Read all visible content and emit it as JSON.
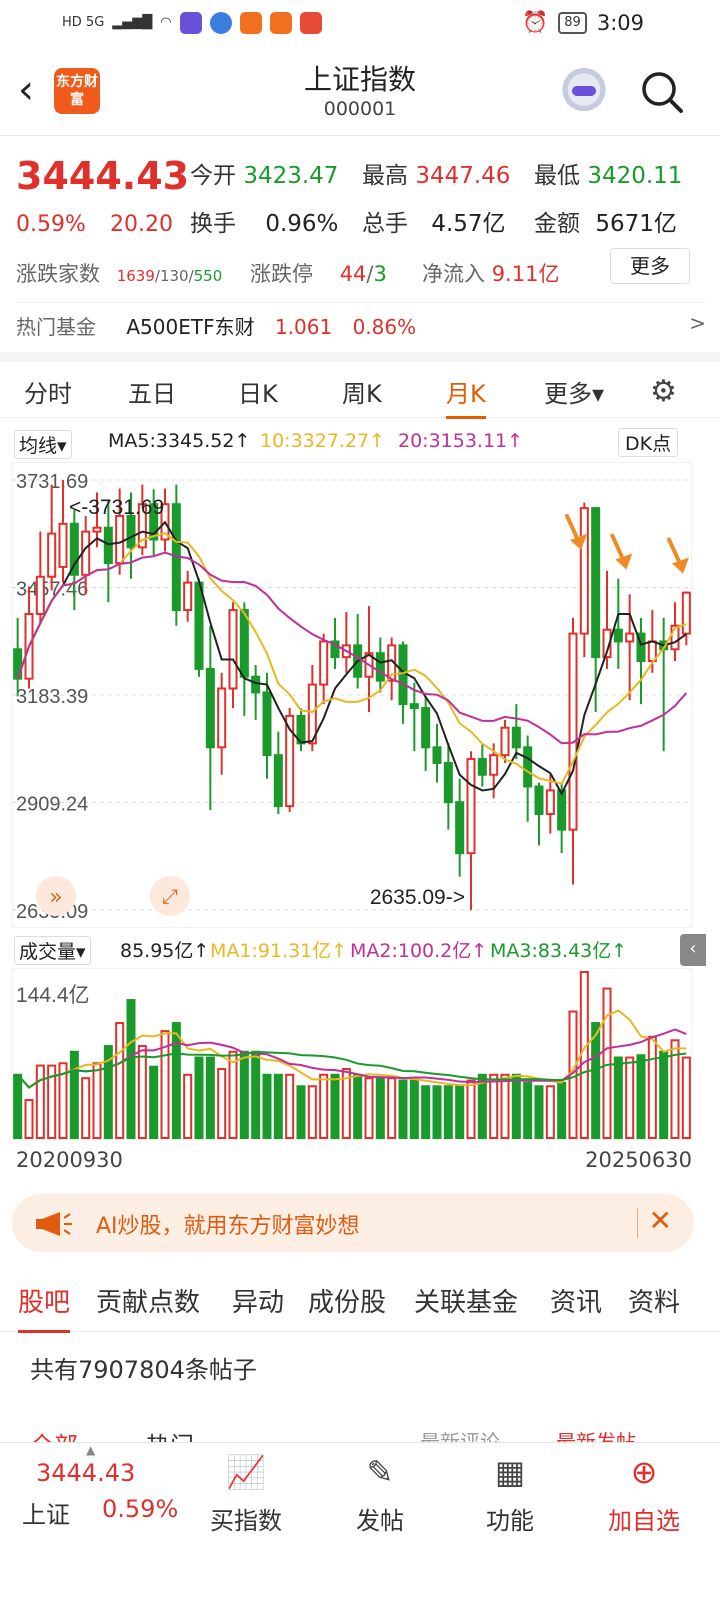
{
  "status_bar": {
    "left_label": "HD 5G",
    "battery": "89",
    "time": "3:09"
  },
  "header": {
    "logo_text": "东方财富",
    "title": "上证指数",
    "code": "000001"
  },
  "quote": {
    "price": "3444.43",
    "change_pct": "0.59%",
    "change_abs": "20.20",
    "open_label": "今开",
    "open": "3423.47",
    "high_label": "最高",
    "high": "3447.46",
    "low_label": "最低",
    "low": "3420.11",
    "turnover_label": "换手",
    "turnover": "0.96%",
    "volume_label": "总手",
    "volume": "4.57亿",
    "amount_label": "金额",
    "amount": "5671亿",
    "breadth_label": "涨跌家数",
    "breadth_up": "1639",
    "breadth_flat": "130",
    "breadth_down": "550",
    "limit_label": "涨跌停",
    "limit_up": "44",
    "limit_down": "3",
    "netflow_label": "净流入",
    "netflow": "9.11亿",
    "more_button": "更多"
  },
  "hot_fund": {
    "label": "热门基金",
    "name": "A500ETF东财",
    "price": "1.061",
    "pct": "0.86%",
    "arrow": ">"
  },
  "period_tabs": [
    {
      "label": "分时"
    },
    {
      "label": "五日"
    },
    {
      "label": "日K"
    },
    {
      "label": "周K"
    },
    {
      "label": "月K"
    },
    {
      "label": "更多▾"
    }
  ],
  "ma_bar": {
    "selector": "均线▾",
    "ma5": "MA5:3345.52↑",
    "ma10": "10:3327.27↑",
    "ma20": "20:3153.11↑",
    "dk": "DK点"
  },
  "vol_bar": {
    "selector": "成交量▾",
    "vol": "85.95亿↑",
    "ma1": "MA1:91.31亿↑",
    "ma2": "MA2:100.2亿↑",
    "ma3": "MA3:83.43亿↑"
  },
  "colors": {
    "up": "#e0302b",
    "down": "#1a9a2b",
    "ma5": "#222222",
    "ma10": "#e8b820",
    "ma20": "#c0309a",
    "accent": "#e65c00",
    "arrow": "#f08a24"
  },
  "chart_data": {
    "type": "candlestick",
    "y_ticks": [
      "3731.69",
      "3457.46",
      "3183.39",
      "2909.24",
      "2635.09"
    ],
    "ylim": [
      2635.09,
      3731.69
    ],
    "max_label": "<-3731.69",
    "min_label": "2635.09->",
    "x_labels": [
      "20200930",
      "20250630"
    ],
    "vol_tick": "144.4亿",
    "vol_max": 144.4,
    "candles": [
      {
        "o": 3300,
        "c": 3225,
        "h": 3380,
        "l": 3180,
        "v": 55
      },
      {
        "o": 3225,
        "c": 3390,
        "h": 3460,
        "l": 3200,
        "v": 33
      },
      {
        "o": 3390,
        "c": 3485,
        "h": 3600,
        "l": 3365,
        "v": 63
      },
      {
        "o": 3485,
        "c": 3595,
        "h": 3720,
        "l": 3450,
        "v": 63
      },
      {
        "o": 3510,
        "c": 3620,
        "h": 3731.69,
        "l": 3470,
        "v": 65
      },
      {
        "o": 3620,
        "c": 3490,
        "h": 3655,
        "l": 3400,
        "v": 75
      },
      {
        "o": 3490,
        "c": 3600,
        "h": 3640,
        "l": 3440,
        "v": 52
      },
      {
        "o": 3600,
        "c": 3610,
        "h": 3700,
        "l": 3560,
        "v": 65
      },
      {
        "o": 3610,
        "c": 3520,
        "h": 3680,
        "l": 3420,
        "v": 80
      },
      {
        "o": 3520,
        "c": 3640,
        "h": 3710,
        "l": 3490,
        "v": 100
      },
      {
        "o": 3640,
        "c": 3560,
        "h": 3700,
        "l": 3480,
        "v": 120
      },
      {
        "o": 3560,
        "c": 3670,
        "h": 3720,
        "l": 3540,
        "v": 80
      },
      {
        "o": 3670,
        "c": 3580,
        "h": 3708,
        "l": 3540,
        "v": 62
      },
      {
        "o": 3580,
        "c": 3670,
        "h": 3710,
        "l": 3550,
        "v": 93
      },
      {
        "o": 3670,
        "c": 3400,
        "h": 3720,
        "l": 3360,
        "v": 100
      },
      {
        "o": 3400,
        "c": 3470,
        "h": 3500,
        "l": 3370,
        "v": 55
      },
      {
        "o": 3470,
        "c": 3250,
        "h": 3480,
        "l": 3230,
        "v": 70
      },
      {
        "o": 3250,
        "c": 3050,
        "h": 3360,
        "l": 2890,
        "v": 70
      },
      {
        "o": 3050,
        "c": 3200,
        "h": 3240,
        "l": 2980,
        "v": 60
      },
      {
        "o": 3200,
        "c": 3400,
        "h": 3420,
        "l": 3150,
        "v": 75
      },
      {
        "o": 3400,
        "c": 3230,
        "h": 3420,
        "l": 3130,
        "v": 75
      },
      {
        "o": 3230,
        "c": 3190,
        "h": 3260,
        "l": 3120,
        "v": 75
      },
      {
        "o": 3190,
        "c": 3030,
        "h": 3240,
        "l": 2970,
        "v": 55
      },
      {
        "o": 3030,
        "c": 2900,
        "h": 3090,
        "l": 2880,
        "v": 55
      },
      {
        "o": 2900,
        "c": 3130,
        "h": 3150,
        "l": 2885,
        "v": 55
      },
      {
        "o": 3130,
        "c": 3060,
        "h": 3150,
        "l": 3040,
        "v": 45
      },
      {
        "o": 3060,
        "c": 3210,
        "h": 3260,
        "l": 3040,
        "v": 45
      },
      {
        "o": 3210,
        "c": 3320,
        "h": 3340,
        "l": 3160,
        "v": 55
      },
      {
        "o": 3320,
        "c": 3280,
        "h": 3380,
        "l": 3250,
        "v": 55
      },
      {
        "o": 3280,
        "c": 3310,
        "h": 3395,
        "l": 3240,
        "v": 60
      },
      {
        "o": 3310,
        "c": 3230,
        "h": 3390,
        "l": 3200,
        "v": 55
      },
      {
        "o": 3230,
        "c": 3290,
        "h": 3410,
        "l": 3140,
        "v": 52
      },
      {
        "o": 3290,
        "c": 3220,
        "h": 3330,
        "l": 3190,
        "v": 52
      },
      {
        "o": 3220,
        "c": 3310,
        "h": 3330,
        "l": 3170,
        "v": 52
      },
      {
        "o": 3310,
        "c": 3160,
        "h": 3320,
        "l": 3110,
        "v": 50
      },
      {
        "o": 3160,
        "c": 3150,
        "h": 3215,
        "l": 3040,
        "v": 50
      },
      {
        "o": 3150,
        "c": 3050,
        "h": 3180,
        "l": 2990,
        "v": 45
      },
      {
        "o": 3050,
        "c": 3010,
        "h": 3110,
        "l": 2960,
        "v": 45
      },
      {
        "o": 3010,
        "c": 2910,
        "h": 3060,
        "l": 2840,
        "v": 45
      },
      {
        "o": 2910,
        "c": 2780,
        "h": 2970,
        "l": 2720,
        "v": 45
      },
      {
        "o": 2780,
        "c": 3020,
        "h": 3040,
        "l": 2635.09,
        "v": 50
      },
      {
        "o": 3020,
        "c": 2980,
        "h": 3060,
        "l": 2950,
        "v": 55
      },
      {
        "o": 2980,
        "c": 3030,
        "h": 3060,
        "l": 2920,
        "v": 55
      },
      {
        "o": 3030,
        "c": 3100,
        "h": 3120,
        "l": 3010,
        "v": 55
      },
      {
        "o": 3100,
        "c": 3050,
        "h": 3160,
        "l": 3020,
        "v": 55
      },
      {
        "o": 3050,
        "c": 2950,
        "h": 3080,
        "l": 2860,
        "v": 48
      },
      {
        "o": 2950,
        "c": 2880,
        "h": 2960,
        "l": 2800,
        "v": 45
      },
      {
        "o": 2880,
        "c": 2940,
        "h": 2980,
        "l": 2830,
        "v": 45
      },
      {
        "o": 2940,
        "c": 2840,
        "h": 2960,
        "l": 2780,
        "v": 48
      },
      {
        "o": 2840,
        "c": 3340,
        "h": 3380,
        "l": 2700,
        "v": 110
      },
      {
        "o": 3340,
        "c": 3660,
        "h": 3674,
        "l": 3280,
        "v": 144.4
      },
      {
        "o": 3660,
        "c": 3280,
        "h": 3620,
        "l": 3140,
        "v": 100
      },
      {
        "o": 3280,
        "c": 3350,
        "h": 3500,
        "l": 3250,
        "v": 130
      },
      {
        "o": 3350,
        "c": 3320,
        "h": 3480,
        "l": 3250,
        "v": 70
      },
      {
        "o": 3320,
        "c": 3340,
        "h": 3440,
        "l": 3170,
        "v": 70
      },
      {
        "o": 3340,
        "c": 3270,
        "h": 3380,
        "l": 3160,
        "v": 72
      },
      {
        "o": 3270,
        "c": 3320,
        "h": 3400,
        "l": 3240,
        "v": 88
      },
      {
        "o": 3320,
        "c": 3300,
        "h": 3380,
        "l": 3040,
        "v": 75
      },
      {
        "o": 3300,
        "c": 3360,
        "h": 3420,
        "l": 3270,
        "v": 85
      },
      {
        "o": 3340,
        "c": 3444.43,
        "h": 3447.46,
        "l": 3310,
        "v": 70
      }
    ]
  }
}
